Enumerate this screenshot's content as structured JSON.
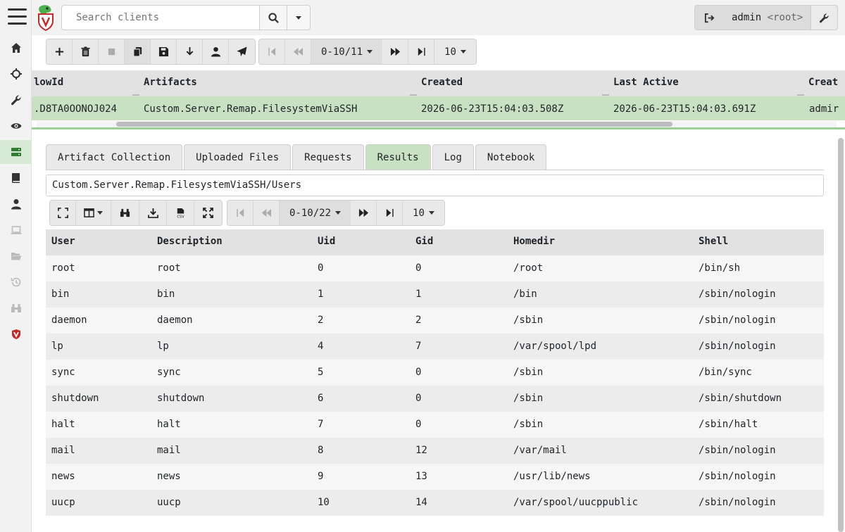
{
  "search": {
    "placeholder": "Search clients"
  },
  "user": {
    "name": "admin",
    "role": "<root>"
  },
  "flows_pager": {
    "range": "0-10/11",
    "page_size": "10"
  },
  "flows_table": {
    "headers": [
      "lowId",
      "Artifacts",
      "Created",
      "Last Active",
      "Creat"
    ],
    "row": [
      ".D8TA0OONOJ024",
      "Custom.Server.Remap.FilesystemViaSSH",
      "2026-06-23T15:04:03.508Z",
      "2026-06-23T15:04:03.691Z",
      "admir"
    ]
  },
  "tabs": [
    "Artifact Collection",
    "Uploaded Files",
    "Requests",
    "Results",
    "Log",
    "Notebook"
  ],
  "active_tab": "Results",
  "artifact_path": "Custom.Server.Remap.FilesystemViaSSH/Users",
  "results_pager": {
    "range": "0-10/22",
    "page_size": "10"
  },
  "results": {
    "headers": [
      "User",
      "Description",
      "Uid",
      "Gid",
      "Homedir",
      "Shell"
    ],
    "rows": [
      [
        "root",
        "root",
        "0",
        "0",
        "/root",
        "/bin/sh"
      ],
      [
        "bin",
        "bin",
        "1",
        "1",
        "/bin",
        "/sbin/nologin"
      ],
      [
        "daemon",
        "daemon",
        "2",
        "2",
        "/sbin",
        "/sbin/nologin"
      ],
      [
        "lp",
        "lp",
        "4",
        "7",
        "/var/spool/lpd",
        "/sbin/nologin"
      ],
      [
        "sync",
        "sync",
        "5",
        "0",
        "/sbin",
        "/bin/sync"
      ],
      [
        "shutdown",
        "shutdown",
        "6",
        "0",
        "/sbin",
        "/sbin/shutdown"
      ],
      [
        "halt",
        "halt",
        "7",
        "0",
        "/sbin",
        "/sbin/halt"
      ],
      [
        "mail",
        "mail",
        "8",
        "12",
        "/var/mail",
        "/sbin/nologin"
      ],
      [
        "news",
        "news",
        "9",
        "13",
        "/usr/lib/news",
        "/sbin/nologin"
      ],
      [
        "uucp",
        "uucp",
        "10",
        "14",
        "/var/spool/uucppublic",
        "/sbin/nologin"
      ]
    ]
  },
  "colors": {
    "active_green": "#c8e1c3",
    "header_gray": "#e2e2e2",
    "sidebar_bg": "#f2f2f2"
  },
  "icons": {
    "sidebar": [
      "home-icon",
      "crosshair-icon",
      "wrench-icon",
      "eye-icon",
      "server-icon",
      "book-icon",
      "user-icon",
      "laptop-icon",
      "folder-open-icon",
      "history-icon",
      "binoculars-icon",
      "velociraptor-shield-icon"
    ],
    "toolbar": [
      "plus-icon",
      "trash-icon",
      "stop-icon",
      "copy-icon",
      "save-icon",
      "download-icon",
      "user-icon",
      "paper-plane-icon"
    ],
    "results_toolbar": [
      "expand-icon",
      "columns-icon",
      "binoculars-icon",
      "download-icon",
      "csv-icon",
      "fullscreen-icon"
    ]
  }
}
